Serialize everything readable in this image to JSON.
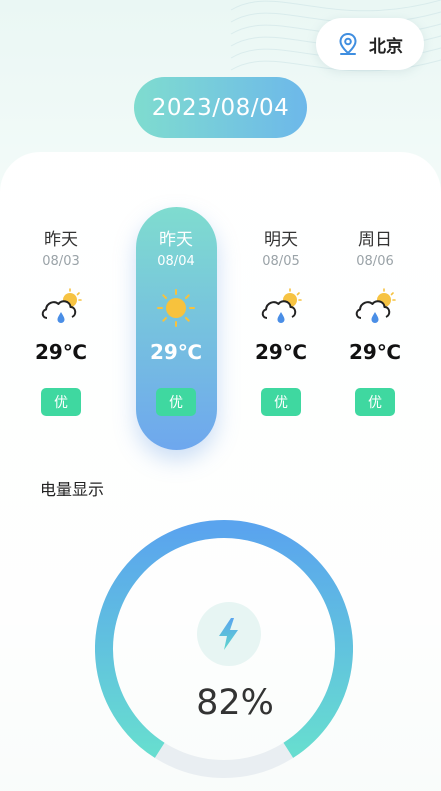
{
  "location": {
    "icon": "location-pin-icon",
    "city": "北京"
  },
  "date": "2023/08/04",
  "forecast": [
    {
      "name": "昨天",
      "date": "08/03",
      "icon": "cloud-sun-rain-icon",
      "temp": "29℃",
      "aqi": "优",
      "active": false
    },
    {
      "name": "昨天",
      "date": "08/04",
      "icon": "sun-icon",
      "temp": "29℃",
      "aqi": "优",
      "active": true
    },
    {
      "name": "明天",
      "date": "08/05",
      "icon": "cloud-sun-rain-icon",
      "temp": "29℃",
      "aqi": "优",
      "active": false
    },
    {
      "name": "周日",
      "date": "08/06",
      "icon": "cloud-sun-rain-icon",
      "temp": "29℃",
      "aqi": "优",
      "active": false
    }
  ],
  "battery": {
    "title": "电量显示",
    "percent_text": "82%",
    "level": 0.82,
    "icon": "lightning-bolt-icon"
  },
  "colors": {
    "accent_start": "#7fdccf",
    "accent_end": "#6ea7ee",
    "aqi_green": "#3fd8a0"
  }
}
